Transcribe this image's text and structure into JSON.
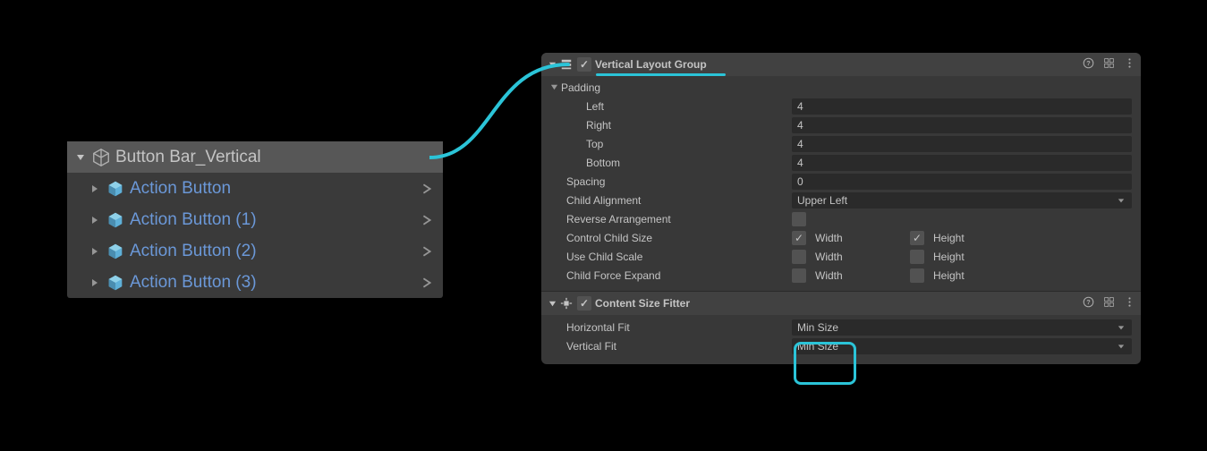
{
  "hierarchy": {
    "parent": "Button Bar_Vertical",
    "children": [
      "Action Button",
      "Action Button (1)",
      "Action Button (2)",
      "Action Button (3)"
    ]
  },
  "vlg": {
    "title": "Vertical Layout Group",
    "padding_label": "Padding",
    "left_label": "Left",
    "left": "4",
    "right_label": "Right",
    "right": "4",
    "top_label": "Top",
    "top": "4",
    "bottom_label": "Bottom",
    "bottom": "4",
    "spacing_label": "Spacing",
    "spacing": "0",
    "child_align_label": "Child Alignment",
    "child_align": "Upper Left",
    "reverse_label": "Reverse Arrangement",
    "control_label": "Control Child Size",
    "use_scale_label": "Use Child Scale",
    "force_expand_label": "Child Force Expand",
    "width_label": "Width",
    "height_label": "Height"
  },
  "csf": {
    "title": "Content Size Fitter",
    "hfit_label": "Horizontal Fit",
    "hfit": "Min Size",
    "vfit_label": "Vertical Fit",
    "vfit": "Min Size"
  },
  "colors": {
    "accent": "#2bc4d8"
  }
}
